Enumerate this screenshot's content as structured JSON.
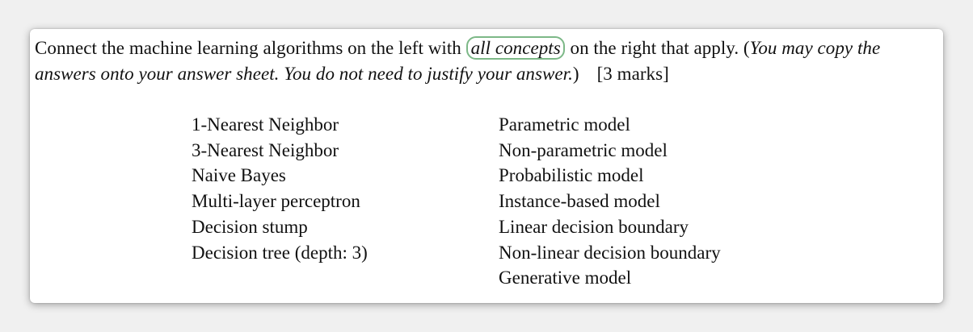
{
  "question": {
    "part1": "Connect the machine learning algorithms on the left with ",
    "highlight": "all concepts",
    "part2": " on the right that apply. (",
    "instructions": "You may copy the answers onto your answer sheet. You do not need to justify your answer.",
    "close_paren": ")",
    "marks": "[3 marks]"
  },
  "algorithms": [
    "1-Nearest Neighbor",
    "3-Nearest Neighbor",
    "Naive Bayes",
    "Multi-layer perceptron",
    "Decision stump",
    "Decision tree (depth: 3)"
  ],
  "concepts": [
    "Parametric model",
    "Non-parametric model",
    "Probabilistic model",
    "Instance-based model",
    "Linear decision boundary",
    "Non-linear decision boundary",
    "Generative model"
  ],
  "colors": {
    "highlight_border": "#7cb887"
  }
}
